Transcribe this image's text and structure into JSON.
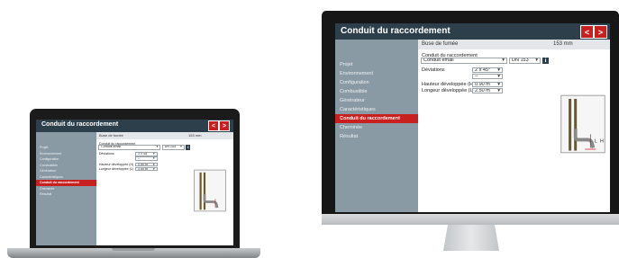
{
  "app": {
    "title": "Conduit du raccordement",
    "nav_prev": "<",
    "nav_next": ">",
    "info_label": "Buse de fumée",
    "info_value": "153 mm"
  },
  "sidebar": {
    "items": [
      {
        "label": "Projet"
      },
      {
        "label": "Environnement"
      },
      {
        "label": "Configuration"
      },
      {
        "label": "Combustible"
      },
      {
        "label": "Générateur"
      },
      {
        "label": "Caractéristiques"
      },
      {
        "label": "Conduit du raccordement",
        "active": true
      },
      {
        "label": "Cheminée"
      },
      {
        "label": "Résultat"
      }
    ]
  },
  "form": {
    "section_label": "Conduit du raccordement",
    "conduit_type": "Conduit émail",
    "diameter": "DN 153",
    "info_icon": "i",
    "deviations_label": "Déviations",
    "deviations_value": "2 x 45°",
    "deviations_value2": "--",
    "hauteur_label": "Hauteur développée (H)",
    "hauteur_value": "0.90 m",
    "longueur_label": "Longeur développée (L)",
    "longueur_value": "2.50 m",
    "dropdown_arrow": "▾",
    "diagram_l": "L",
    "diagram_h": "H"
  },
  "colors": {
    "titlebar": "#2d3f4a",
    "sidebar": "#8a9aa4",
    "accent": "#c8201f"
  }
}
